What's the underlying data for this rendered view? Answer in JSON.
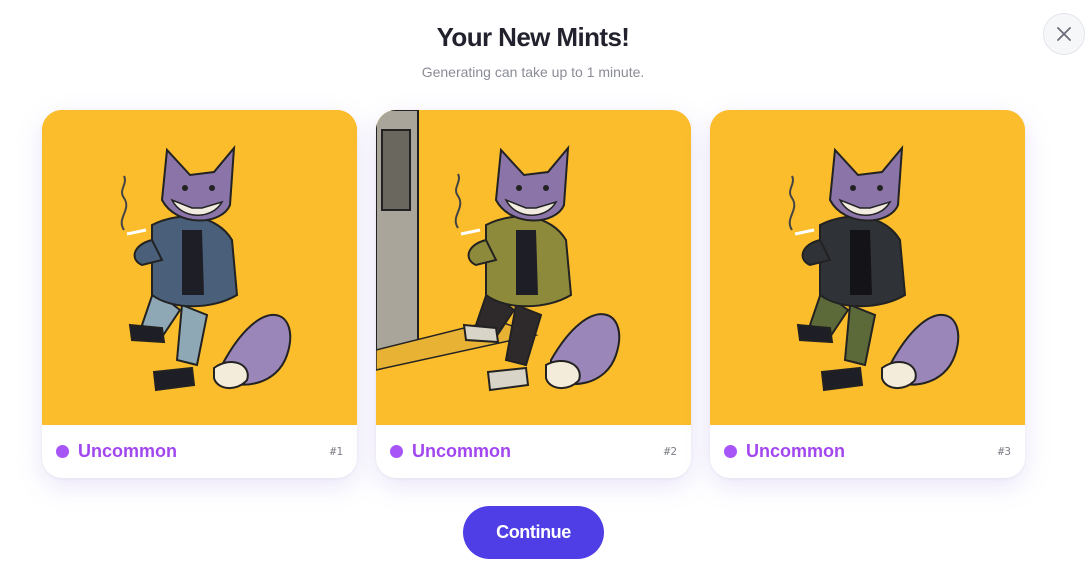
{
  "modal": {
    "title": "Your New Mints!",
    "subtitle": "Generating can take up to 1 minute.",
    "close_icon": "close-icon"
  },
  "cards": [
    {
      "rarity": "Uncommon",
      "number": "#1",
      "jacket": "denim",
      "pants": "patterned"
    },
    {
      "rarity": "Uncommon",
      "number": "#2",
      "jacket": "olive",
      "pants": "black",
      "background_detail": "subway-door"
    },
    {
      "rarity": "Uncommon",
      "number": "#3",
      "jacket": "black-denim",
      "pants": "olive"
    }
  ],
  "colors": {
    "art_background": "#fbbd2c",
    "rarity_dot": "#a855f7",
    "rarity_text": "#a247f0",
    "accent": "#4f3ee6"
  },
  "actions": {
    "continue_label": "Continue"
  }
}
